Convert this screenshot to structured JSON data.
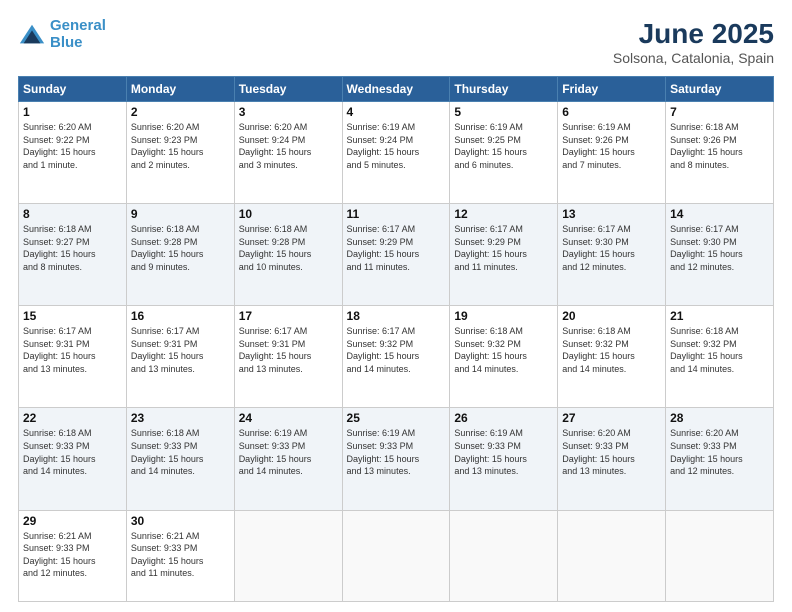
{
  "logo": {
    "line1": "General",
    "line2": "Blue"
  },
  "title": "June 2025",
  "subtitle": "Solsona, Catalonia, Spain",
  "headers": [
    "Sunday",
    "Monday",
    "Tuesday",
    "Wednesday",
    "Thursday",
    "Friday",
    "Saturday"
  ],
  "weeks": [
    [
      {
        "day": "1",
        "info": "Sunrise: 6:20 AM\nSunset: 9:22 PM\nDaylight: 15 hours\nand 1 minute."
      },
      {
        "day": "2",
        "info": "Sunrise: 6:20 AM\nSunset: 9:23 PM\nDaylight: 15 hours\nand 2 minutes."
      },
      {
        "day": "3",
        "info": "Sunrise: 6:20 AM\nSunset: 9:24 PM\nDaylight: 15 hours\nand 3 minutes."
      },
      {
        "day": "4",
        "info": "Sunrise: 6:19 AM\nSunset: 9:24 PM\nDaylight: 15 hours\nand 5 minutes."
      },
      {
        "day": "5",
        "info": "Sunrise: 6:19 AM\nSunset: 9:25 PM\nDaylight: 15 hours\nand 6 minutes."
      },
      {
        "day": "6",
        "info": "Sunrise: 6:19 AM\nSunset: 9:26 PM\nDaylight: 15 hours\nand 7 minutes."
      },
      {
        "day": "7",
        "info": "Sunrise: 6:18 AM\nSunset: 9:26 PM\nDaylight: 15 hours\nand 8 minutes."
      }
    ],
    [
      {
        "day": "8",
        "info": "Sunrise: 6:18 AM\nSunset: 9:27 PM\nDaylight: 15 hours\nand 8 minutes."
      },
      {
        "day": "9",
        "info": "Sunrise: 6:18 AM\nSunset: 9:28 PM\nDaylight: 15 hours\nand 9 minutes."
      },
      {
        "day": "10",
        "info": "Sunrise: 6:18 AM\nSunset: 9:28 PM\nDaylight: 15 hours\nand 10 minutes."
      },
      {
        "day": "11",
        "info": "Sunrise: 6:17 AM\nSunset: 9:29 PM\nDaylight: 15 hours\nand 11 minutes."
      },
      {
        "day": "12",
        "info": "Sunrise: 6:17 AM\nSunset: 9:29 PM\nDaylight: 15 hours\nand 11 minutes."
      },
      {
        "day": "13",
        "info": "Sunrise: 6:17 AM\nSunset: 9:30 PM\nDaylight: 15 hours\nand 12 minutes."
      },
      {
        "day": "14",
        "info": "Sunrise: 6:17 AM\nSunset: 9:30 PM\nDaylight: 15 hours\nand 12 minutes."
      }
    ],
    [
      {
        "day": "15",
        "info": "Sunrise: 6:17 AM\nSunset: 9:31 PM\nDaylight: 15 hours\nand 13 minutes."
      },
      {
        "day": "16",
        "info": "Sunrise: 6:17 AM\nSunset: 9:31 PM\nDaylight: 15 hours\nand 13 minutes."
      },
      {
        "day": "17",
        "info": "Sunrise: 6:17 AM\nSunset: 9:31 PM\nDaylight: 15 hours\nand 13 minutes."
      },
      {
        "day": "18",
        "info": "Sunrise: 6:17 AM\nSunset: 9:32 PM\nDaylight: 15 hours\nand 14 minutes."
      },
      {
        "day": "19",
        "info": "Sunrise: 6:18 AM\nSunset: 9:32 PM\nDaylight: 15 hours\nand 14 minutes."
      },
      {
        "day": "20",
        "info": "Sunrise: 6:18 AM\nSunset: 9:32 PM\nDaylight: 15 hours\nand 14 minutes."
      },
      {
        "day": "21",
        "info": "Sunrise: 6:18 AM\nSunset: 9:32 PM\nDaylight: 15 hours\nand 14 minutes."
      }
    ],
    [
      {
        "day": "22",
        "info": "Sunrise: 6:18 AM\nSunset: 9:33 PM\nDaylight: 15 hours\nand 14 minutes."
      },
      {
        "day": "23",
        "info": "Sunrise: 6:18 AM\nSunset: 9:33 PM\nDaylight: 15 hours\nand 14 minutes."
      },
      {
        "day": "24",
        "info": "Sunrise: 6:19 AM\nSunset: 9:33 PM\nDaylight: 15 hours\nand 14 minutes."
      },
      {
        "day": "25",
        "info": "Sunrise: 6:19 AM\nSunset: 9:33 PM\nDaylight: 15 hours\nand 13 minutes."
      },
      {
        "day": "26",
        "info": "Sunrise: 6:19 AM\nSunset: 9:33 PM\nDaylight: 15 hours\nand 13 minutes."
      },
      {
        "day": "27",
        "info": "Sunrise: 6:20 AM\nSunset: 9:33 PM\nDaylight: 15 hours\nand 13 minutes."
      },
      {
        "day": "28",
        "info": "Sunrise: 6:20 AM\nSunset: 9:33 PM\nDaylight: 15 hours\nand 12 minutes."
      }
    ],
    [
      {
        "day": "29",
        "info": "Sunrise: 6:21 AM\nSunset: 9:33 PM\nDaylight: 15 hours\nand 12 minutes."
      },
      {
        "day": "30",
        "info": "Sunrise: 6:21 AM\nSunset: 9:33 PM\nDaylight: 15 hours\nand 11 minutes."
      },
      {
        "day": "",
        "info": ""
      },
      {
        "day": "",
        "info": ""
      },
      {
        "day": "",
        "info": ""
      },
      {
        "day": "",
        "info": ""
      },
      {
        "day": "",
        "info": ""
      }
    ]
  ]
}
